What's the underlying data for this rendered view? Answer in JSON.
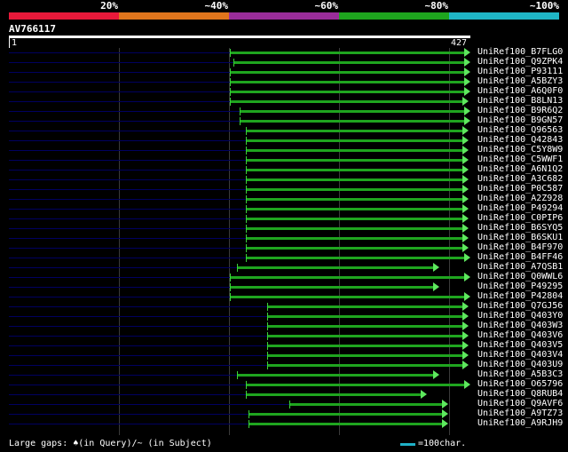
{
  "legend": {
    "labels": [
      "20%",
      "~40%",
      "~60%",
      "~80%",
      "~100%"
    ],
    "colors": [
      "#e8193a",
      "#e0751c",
      "#9a2d9a",
      "#1ea51e",
      "#1fb6c6"
    ]
  },
  "query": {
    "title": "AV766117",
    "start": "1",
    "end": "427",
    "length": 427
  },
  "hits": [
    {
      "label": "UniRef100_B7FLG0",
      "start": 208,
      "end": 427
    },
    {
      "label": "UniRef100_Q9ZPK4",
      "start": 211,
      "end": 427
    },
    {
      "label": "UniRef100_P93111",
      "start": 208,
      "end": 427
    },
    {
      "label": "UniRef100_A5BZY3",
      "start": 208,
      "end": 427
    },
    {
      "label": "UniRef100_A6Q0F0",
      "start": 208,
      "end": 427
    },
    {
      "label": "UniRef100_B8LN13",
      "start": 208,
      "end": 425
    },
    {
      "label": "UniRef100_B9R6Q2",
      "start": 217,
      "end": 427
    },
    {
      "label": "UniRef100_B9GN57",
      "start": 217,
      "end": 427
    },
    {
      "label": "UniRef100_Q96563",
      "start": 223,
      "end": 425
    },
    {
      "label": "UniRef100_Q42843",
      "start": 223,
      "end": 425
    },
    {
      "label": "UniRef100_C5Y8W9",
      "start": 223,
      "end": 425
    },
    {
      "label": "UniRef100_C5WWF1",
      "start": 223,
      "end": 425
    },
    {
      "label": "UniRef100_A6N1Q2",
      "start": 223,
      "end": 425
    },
    {
      "label": "UniRef100_A3C682",
      "start": 223,
      "end": 425
    },
    {
      "label": "UniRef100_P0C587",
      "start": 223,
      "end": 425
    },
    {
      "label": "UniRef100_A2Z928",
      "start": 223,
      "end": 425
    },
    {
      "label": "UniRef100_P49294",
      "start": 223,
      "end": 425
    },
    {
      "label": "UniRef100_C0PIP6",
      "start": 223,
      "end": 425
    },
    {
      "label": "UniRef100_B6SYQ5",
      "start": 223,
      "end": 425
    },
    {
      "label": "UniRef100_B6SKU1",
      "start": 223,
      "end": 425
    },
    {
      "label": "UniRef100_B4F970",
      "start": 223,
      "end": 425
    },
    {
      "label": "UniRef100_B4FF46",
      "start": 223,
      "end": 427
    },
    {
      "label": "UniRef100_A7QSB1",
      "start": 214,
      "end": 398
    },
    {
      "label": "UniRef100_Q0WWL6",
      "start": 208,
      "end": 427
    },
    {
      "label": "UniRef100_P49295",
      "start": 208,
      "end": 398
    },
    {
      "label": "UniRef100_P42804",
      "start": 208,
      "end": 427
    },
    {
      "label": "UniRef100_Q7GJ56",
      "start": 243,
      "end": 425
    },
    {
      "label": "UniRef100_Q403Y0",
      "start": 243,
      "end": 425
    },
    {
      "label": "UniRef100_Q403W3",
      "start": 243,
      "end": 425
    },
    {
      "label": "UniRef100_Q403V6",
      "start": 243,
      "end": 425
    },
    {
      "label": "UniRef100_Q403V5",
      "start": 243,
      "end": 425
    },
    {
      "label": "UniRef100_Q403V4",
      "start": 243,
      "end": 425
    },
    {
      "label": "UniRef100_Q403U9",
      "start": 243,
      "end": 425
    },
    {
      "label": "UniRef100_A5B3C3",
      "start": 214,
      "end": 398
    },
    {
      "label": "UniRef100_O65796",
      "start": 223,
      "end": 427
    },
    {
      "label": "UniRef100_Q8RUB4",
      "start": 223,
      "end": 386
    },
    {
      "label": "UniRef100_Q9AVF6",
      "start": 263,
      "end": 406
    },
    {
      "label": "UniRef100_A9TZ73",
      "start": 225,
      "end": 406
    },
    {
      "label": "UniRef100_A9RJH9",
      "start": 225,
      "end": 406
    }
  ],
  "footer": {
    "gaps_text": "Large gaps: ♠(in Query)/~ (in Subject)",
    "scale_text": "=100char."
  }
}
